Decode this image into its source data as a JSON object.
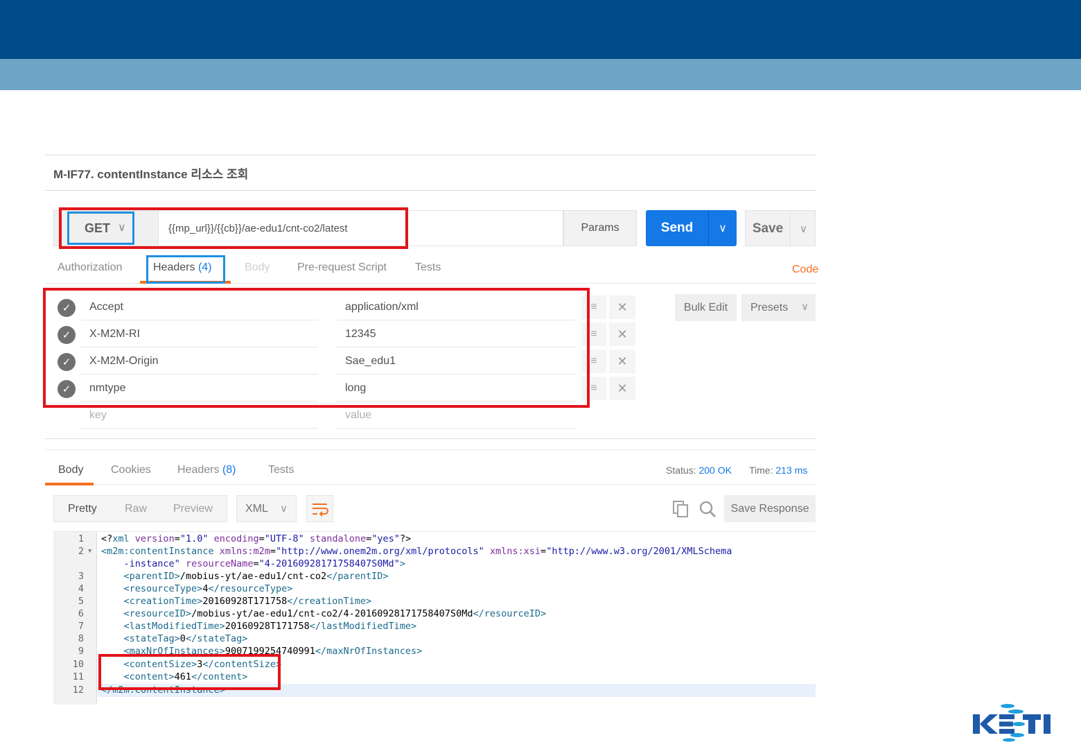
{
  "brand": {
    "logo": "KETI",
    "colors": {
      "top_band": "#004a87",
      "sub_band": "#6fa5c6",
      "accent": "#f47023",
      "primary": "#1478e6",
      "highlight_box": "#e2141b",
      "focus_box": "#1e8fe0"
    }
  },
  "slide": {
    "title": "M-IF77. contentInstance 리소스 조회"
  },
  "request": {
    "method": "GET",
    "url": "{{mp_url}}/{{cb}}/ae-edu1/cnt-co2/latest",
    "params_label": "Params",
    "send_label": "Send",
    "save_label": "Save"
  },
  "request_tabs": {
    "authorization": "Authorization",
    "headers": "Headers",
    "headers_count": "(4)",
    "body": "Body",
    "prerequest": "Pre-request Script",
    "tests": "Tests",
    "code": "Code"
  },
  "headers": [
    {
      "key": "Accept",
      "value": "application/xml",
      "enabled": true
    },
    {
      "key": "X-M2M-RI",
      "value": "12345",
      "enabled": true
    },
    {
      "key": "X-M2M-Origin",
      "value": "Sae_edu1",
      "enabled": true
    },
    {
      "key": "nmtype",
      "value": "long",
      "enabled": true
    }
  ],
  "new_header": {
    "key_placeholder": "key",
    "value_placeholder": "value"
  },
  "header_tools": {
    "bulk_edit": "Bulk Edit",
    "presets": "Presets"
  },
  "response_tabs": {
    "body": "Body",
    "cookies": "Cookies",
    "headers": "Headers",
    "headers_count": "(8)",
    "tests": "Tests"
  },
  "response_meta": {
    "status_label": "Status:",
    "status_value": "200 OK",
    "time_label": "Time:",
    "time_value": "213 ms"
  },
  "response_view": {
    "pretty": "Pretty",
    "raw": "Raw",
    "preview": "Preview",
    "format": "XML",
    "save_response": "Save Response"
  },
  "code_lines": [
    {
      "n": "1"
    },
    {
      "n": "2"
    },
    {
      "n": ""
    },
    {
      "n": "3"
    },
    {
      "n": "4"
    },
    {
      "n": "5"
    },
    {
      "n": "6"
    },
    {
      "n": "7"
    },
    {
      "n": "8"
    },
    {
      "n": "9"
    },
    {
      "n": "10"
    },
    {
      "n": "11"
    },
    {
      "n": "12"
    }
  ],
  "xml": {
    "decl_version": "\"1.0\"",
    "decl_encoding": "\"UTF-8\"",
    "decl_standalone": "\"yes\"",
    "root_tag": "m2m:contentInstance",
    "xmlns_m2m": "\"http://www.onem2m.org/xml/protocols\"",
    "xmlns_xsi_part1": "\"http://www.w3.org/2001/XMLSchema",
    "xmlns_xsi_part2": "-instance\"",
    "resource_name": "\"4-20160928171758407S0Md\"",
    "parentID": "/mobius-yt/ae-edu1/cnt-co2",
    "resourceType": "4",
    "creationTime": "20160928T171758",
    "resourceID": "/mobius-yt/ae-edu1/cnt-co2/4-20160928171758407S0Md",
    "lastModifiedTime": "20160928T171758",
    "stateTag": "0",
    "maxNrOfInstances": "9007199254740991",
    "contentSize": "3",
    "content": "461"
  }
}
